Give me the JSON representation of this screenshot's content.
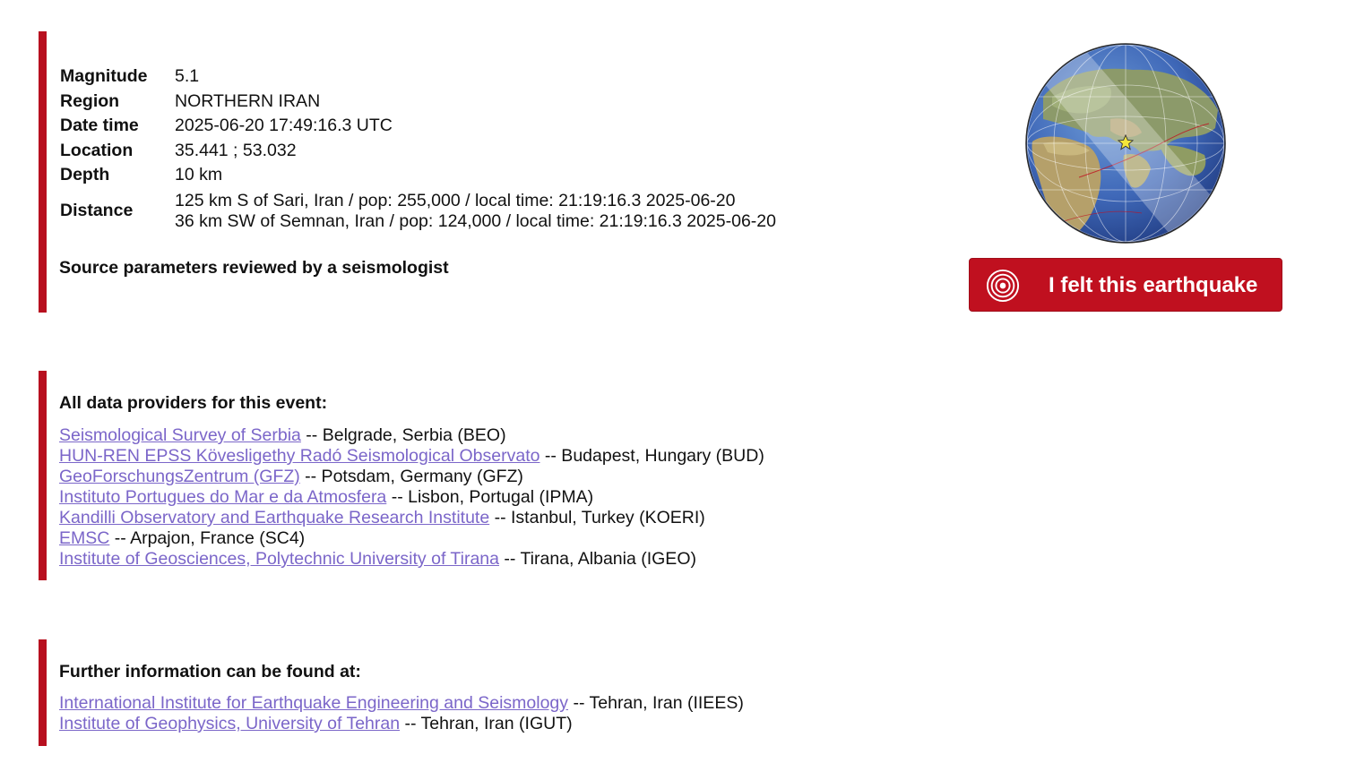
{
  "event": {
    "labels": {
      "magnitude": "Magnitude",
      "region": "Region",
      "datetime": "Date time",
      "location": "Location",
      "depth": "Depth",
      "distance": "Distance"
    },
    "magnitude": "5.1",
    "region": "NORTHERN IRAN",
    "datetime": "2025-06-20 17:49:16.3 UTC",
    "location": "35.441 ; 53.032",
    "depth": "10 km",
    "distances": [
      "125 km S of Sari, Iran / pop: 255,000 / local time: 21:19:16.3 2025-06-20",
      "36 km SW of Semnan, Iran / pop: 124,000 / local time: 21:19:16.3 2025-06-20"
    ],
    "reviewed_note": "Source parameters reviewed by a seismologist"
  },
  "felt_button": {
    "label": "I felt this earthquake",
    "icon": "concentric-target-icon"
  },
  "globe": {
    "icon": "globe-map-icon",
    "epicenter_marker": "star-icon",
    "epicenter_color": "#f5e63a"
  },
  "providers": {
    "heading": "All data providers for this event:",
    "items": [
      {
        "name": "Seismological Survey of Serbia",
        "suffix": " -- Belgrade, Serbia (BEO)"
      },
      {
        "name": "HUN-REN EPSS Kövesligethy Radó Seismological Observato",
        "suffix": " -- Budapest, Hungary (BUD)"
      },
      {
        "name": "GeoForschungsZentrum (GFZ)",
        "suffix": " -- Potsdam, Germany (GFZ)"
      },
      {
        "name": "Instituto Portugues do Mar e da Atmosfera",
        "suffix": " -- Lisbon, Portugal (IPMA)"
      },
      {
        "name": "Kandilli Observatory and Earthquake Research Institute",
        "suffix": " -- Istanbul, Turkey (KOERI)"
      },
      {
        "name": "EMSC",
        "suffix": " -- Arpajon, France (SC4)"
      },
      {
        "name": "Institute of Geosciences, Polytechnic University of Tirana",
        "suffix": " -- Tirana, Albania (IGEO)"
      }
    ]
  },
  "further": {
    "heading": "Further information can be found at:",
    "items": [
      {
        "name": "International Institute for Earthquake Engineering and Seismology",
        "suffix": " -- Tehran, Iran (IIEES)"
      },
      {
        "name": "Institute of Geophysics, University of Tehran",
        "suffix": " -- Tehran, Iran (IGUT)"
      }
    ]
  },
  "colors": {
    "accent": "#b8101f",
    "button": "#c0101f",
    "link": "#7b66c9"
  }
}
